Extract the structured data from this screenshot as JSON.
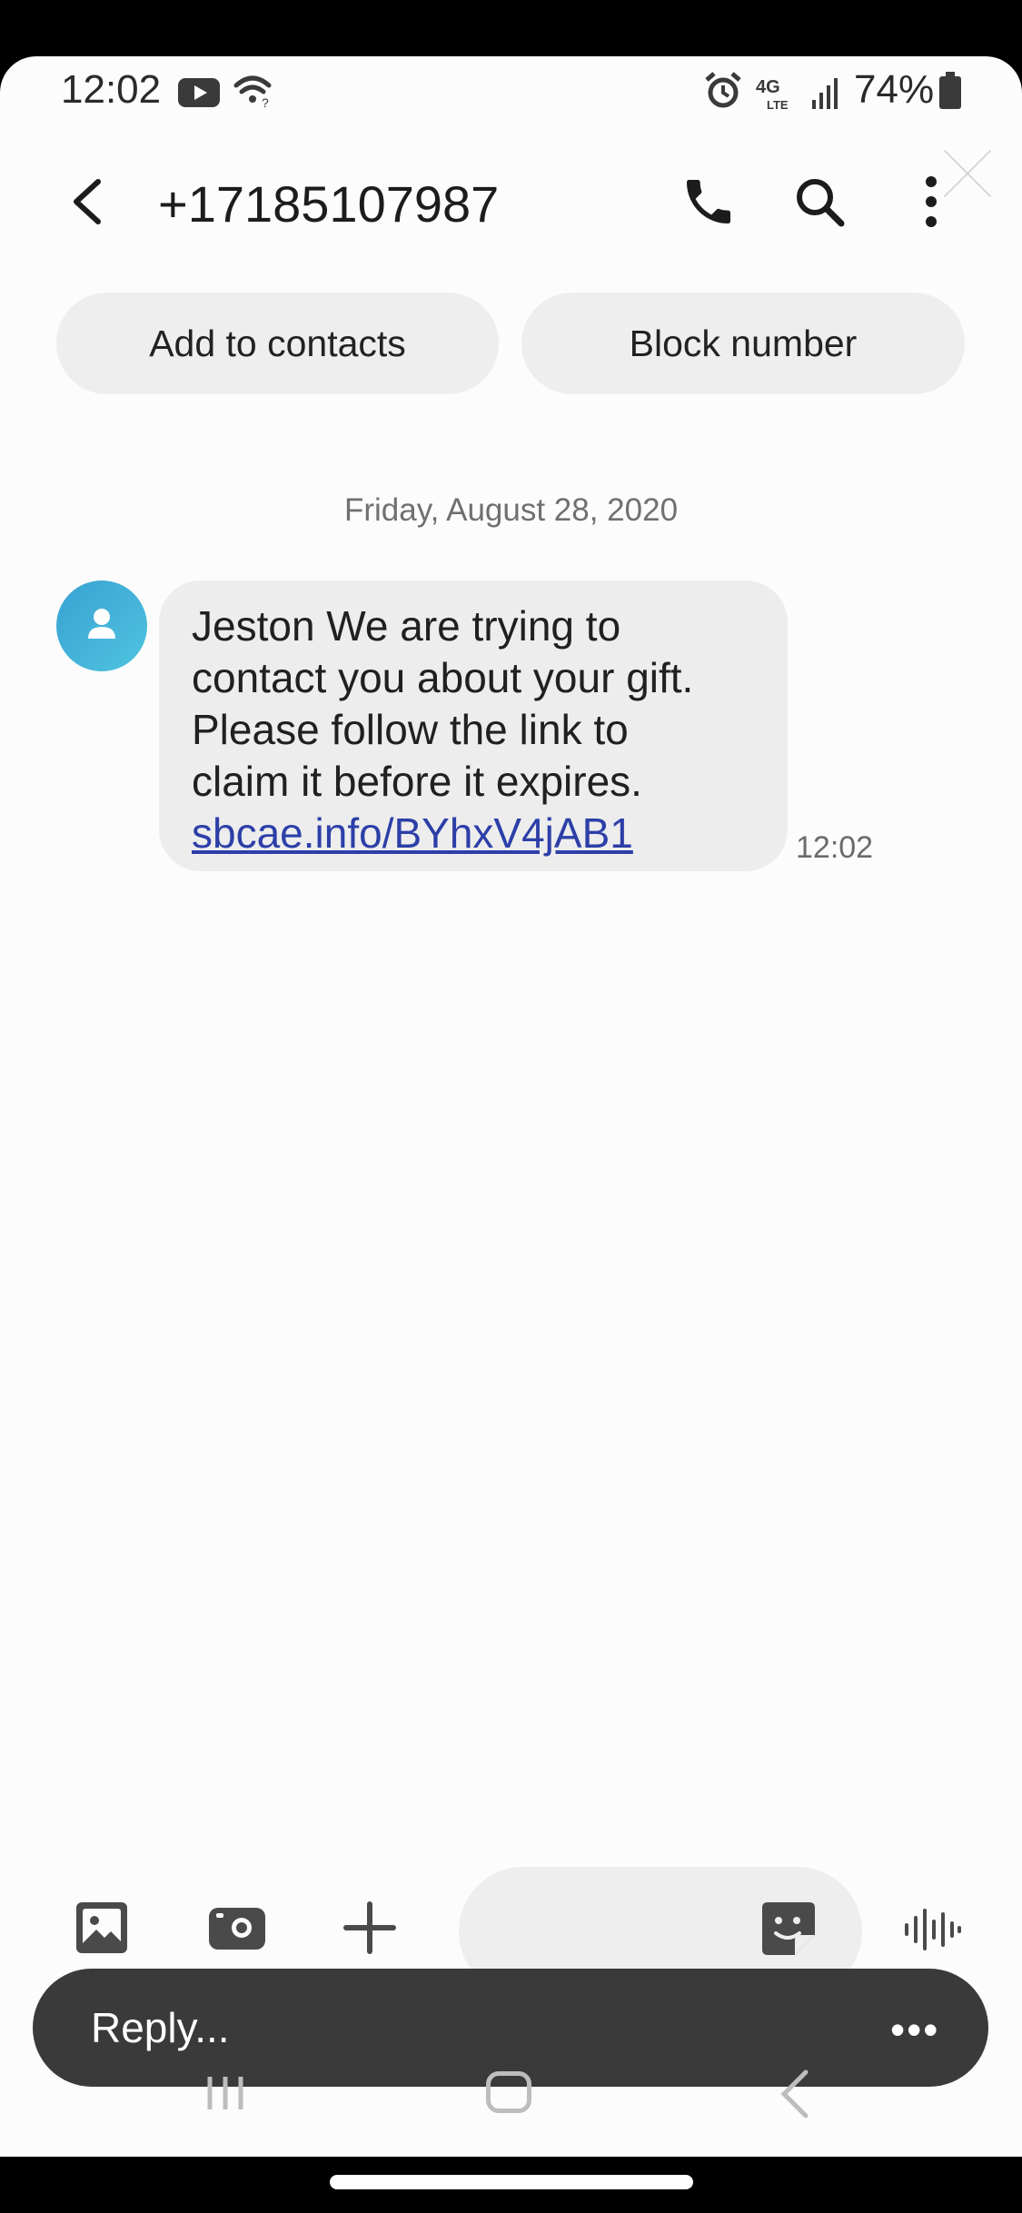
{
  "status_bar": {
    "time": "12:02",
    "battery": "74%",
    "icons": [
      "youtube-icon",
      "wifi-icon",
      "alarm-icon",
      "lte-icon",
      "signal-icon",
      "battery-icon"
    ]
  },
  "header": {
    "title": "+17185107987",
    "icons": [
      "back-icon",
      "call-icon",
      "search-icon",
      "more-vert-icon",
      "close-icon"
    ]
  },
  "actions": {
    "add_contact": "Add to contacts",
    "block_number": "Block number"
  },
  "conversation": {
    "date": "Friday, August 28, 2020",
    "message": {
      "text_lines": [
        "Jeston We are trying to",
        "contact you about your gift.",
        "Please follow the link to",
        "claim it before it expires."
      ],
      "link": "sbcae.info/BYhxV4jAB1",
      "time": "12:02"
    }
  },
  "composer": {
    "placeholder": "Reply...",
    "more": "•••",
    "tools": [
      "gallery-icon",
      "camera-icon",
      "plus-icon",
      "sticker-icon",
      "voice-icon"
    ]
  },
  "colors": {
    "link": "#2c3fa8",
    "avatar": "#3eaed9",
    "bubble": "#ededed",
    "reply_bar": "#3a3a3a"
  }
}
